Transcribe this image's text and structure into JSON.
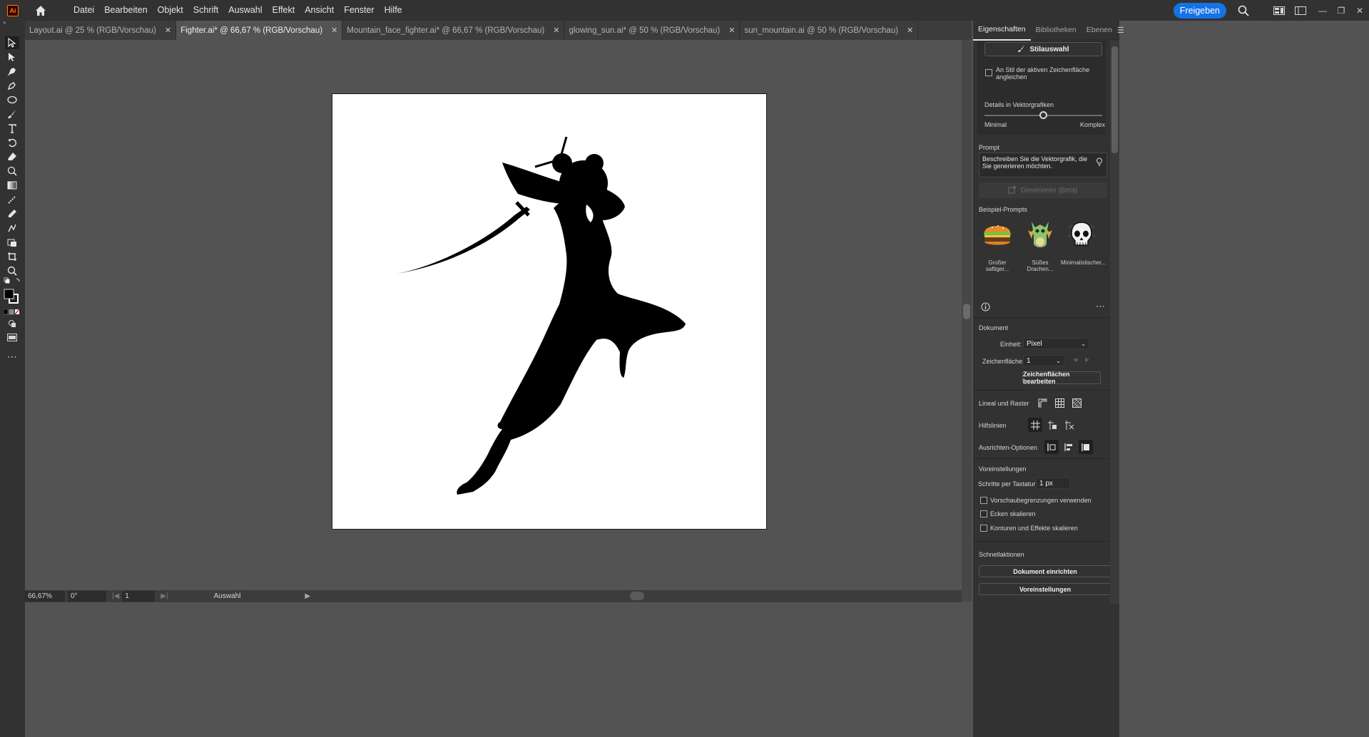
{
  "app": {
    "logo_text": "Ai"
  },
  "menu": [
    "Datei",
    "Bearbeiten",
    "Objekt",
    "Schrift",
    "Auswahl",
    "Effekt",
    "Ansicht",
    "Fenster",
    "Hilfe"
  ],
  "share_label": "Freigeben",
  "tabs": [
    {
      "label": "Layout.ai @ 25 % (RGB/Vorschau)",
      "active": false
    },
    {
      "label": "Fighter.ai* @ 66,67 % (RGB/Vorschau)",
      "active": true
    },
    {
      "label": "Mountain_face_fighter.ai* @ 66,67 % (RGB/Vorschau)",
      "active": false
    },
    {
      "label": "glowing_sun.ai* @ 50 % (RGB/Vorschau)",
      "active": false
    },
    {
      "label": "sun_mountain.ai @ 50 % (RGB/Vorschau)",
      "active": false
    }
  ],
  "status": {
    "zoom": "66,67%",
    "rotation": "0°",
    "artboard_nav": "1",
    "tool_label": "Auswahl"
  },
  "panel": {
    "tabs": [
      "Eigenschaften",
      "Bibliotheken",
      "Ebenen"
    ],
    "style_button": "Stilauswahl",
    "match_style_label": "An Stil der aktiven Zeichenfläche angleichen",
    "detail_label": "Details in Vektorgrafiken",
    "detail_level": 0.5,
    "detail_min": "Minimal",
    "detail_max": "Komplex",
    "prompt_heading": "Prompt",
    "prompt_placeholder": "Beschreiben Sie die Vektorgrafik, die Sie generieren möchten.",
    "generate_label": "Generieren (Beta)",
    "examples_heading": "Beispiel-Prompts",
    "examples": [
      {
        "label": "Großer saftiger...",
        "icon": "burger-icon"
      },
      {
        "label": "Süßes Drachen...",
        "icon": "dragon-icon"
      },
      {
        "label": "Minimalistischer...",
        "icon": "skull-icon"
      }
    ],
    "document_heading": "Dokument",
    "unit_label": "Einheit:",
    "unit_value": "Pixel",
    "artboard_label": "Zeichenfläche:",
    "artboard_value": "1",
    "edit_artboards_label": "Zeichenflächen bearbeiten",
    "rulers_label": "Lineal und Raster",
    "guides_label": "Hilfslinien",
    "align_label": "Ausrichten-Optionen",
    "prefs_heading": "Voreinstellungen",
    "keyboard_inc_label": "Schritte per Tastatur:",
    "keyboard_inc_value": "1 px",
    "check_preview_bounds": "Vorschaubegrenzungen verwenden",
    "check_scale_corners": "Ecken skalieren",
    "check_scale_strokes": "Konturen und Effekte skalieren",
    "quick_actions_heading": "Schnellaktionen",
    "doc_setup_label": "Dokument einrichten",
    "preferences_label": "Voreinstellungen"
  },
  "colors": {
    "accent": "#1473e6",
    "panel_bg": "#323232",
    "canvas_bg": "#535353"
  }
}
